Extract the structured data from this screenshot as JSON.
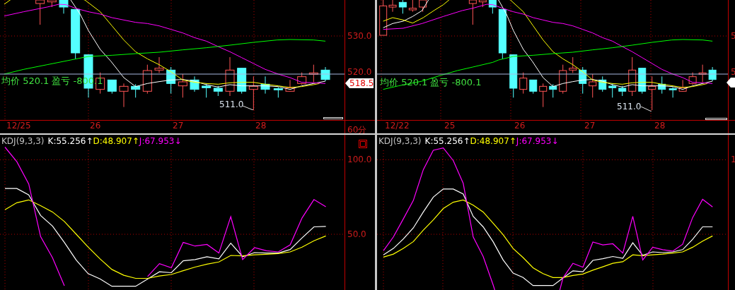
{
  "panes": [
    {
      "price_axis": {
        "labels": [
          "530.0",
          "520.0"
        ]
      },
      "price_tag": "518.5",
      "summary": "均价 520.1 盈亏 -800.1",
      "low_marker": "511.0",
      "time_axis": {
        "labels": [
          "12/25",
          "26",
          "27",
          "28"
        ],
        "period": "60分"
      },
      "kdj": {
        "legend": [
          {
            "kind": "name",
            "text": "KDJ(9,3,3)"
          },
          {
            "kind": "k",
            "text": "K:55.256↑"
          },
          {
            "kind": "d",
            "text": "D:48.907↑"
          },
          {
            "kind": "j",
            "text": "J:67.953↓"
          }
        ],
        "chart_data": {
          "type": "line",
          "grid": true,
          "ylim": [
            12.6,
            116.8
          ],
          "yticks": [
            {
              "value": 100,
              "label": "100.0"
            },
            {
              "value": 50,
              "label": "50.0"
            }
          ],
          "series": [
            {
              "color": "#ffffff",
              "values": [
                80.7,
                80.7,
                76.4,
                62.6,
                55.5,
                44.5,
                32.7,
                23.6,
                20.1,
                15.1,
                15.1,
                15.1,
                20,
                24.8,
                24.2,
                32.2,
                33,
                34.9,
                33.5,
                44,
                35,
                37.7,
                37.4,
                37.4,
                39.8,
                47.6,
                55,
                55.3
              ]
            },
            {
              "color": "#ffff00",
              "values": [
                66.5,
                71.2,
                73.1,
                69.2,
                65,
                58.6,
                50,
                41.4,
                33.5,
                26.4,
                22.5,
                20.4,
                20.4,
                22,
                23,
                25.6,
                28,
                30,
                31.4,
                35.8,
                35.5,
                36.2,
                36.6,
                37.1,
                38.2,
                41.4,
                45.6,
                48.9
              ]
            },
            {
              "color": "#ff00ff",
              "values": [
                108.5,
                98.7,
                83.8,
                48.4,
                34.3,
                15.4,
                null,
                null,
                null,
                null,
                null,
                null,
                21.7,
                30.3,
                27.5,
                44.5,
                42.1,
                43.2,
                37.4,
                61.8,
                33,
                41,
                39,
                38.2,
                42.9,
                61,
                73.3,
                68.5
              ]
            }
          ]
        }
      }
    },
    {
      "price_axis": {
        "labels": [
          "5",
          "5"
        ]
      },
      "summary": "均价 520.1 盈亏 -800.1",
      "low_marker": "511.0",
      "time_axis": {
        "labels": [
          "12/22",
          "25",
          "26",
          "27",
          "28"
        ]
      },
      "kdj": {
        "legend": [
          {
            "kind": "name",
            "text": "KDJ(9,3,3)"
          },
          {
            "kind": "k",
            "text": "K:55.256↑"
          },
          {
            "kind": "d",
            "text": "D:48.907↑"
          },
          {
            "kind": "j",
            "text": "J:67.953↓"
          }
        ],
        "axis_labels": [
          "1"
        ]
      }
    }
  ]
}
